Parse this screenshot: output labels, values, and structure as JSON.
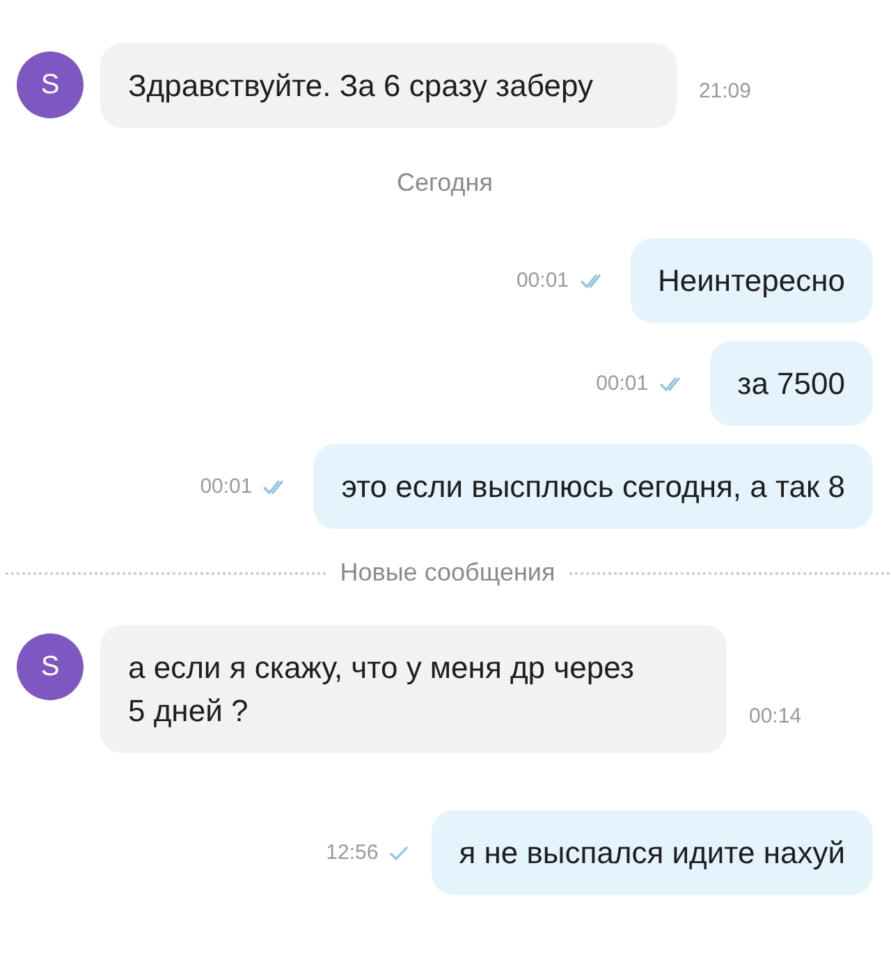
{
  "messages": [
    {
      "kind": "incoming",
      "avatar": "S",
      "text": "Здравствуйте. За 6 сразу заберу",
      "time": "21:09"
    },
    {
      "kind": "date",
      "text": "Сегодня"
    },
    {
      "kind": "outgoing",
      "text": "Неинтересно",
      "time": "00:01",
      "read": true
    },
    {
      "kind": "outgoing",
      "text": "за 7500",
      "time": "00:01",
      "read": true
    },
    {
      "kind": "outgoing",
      "text": "это если высплюсь сегодня, а так 8",
      "time": "00:01",
      "read": true
    },
    {
      "kind": "new",
      "text": "Новые сообщения"
    },
    {
      "kind": "incoming",
      "avatar": "S",
      "text": "а если я скажу, что у меня др через 5 дней ?",
      "time": "00:14"
    },
    {
      "kind": "outgoing",
      "text": "я не выспался идите нахуй",
      "time": "12:56",
      "read": false
    }
  ]
}
